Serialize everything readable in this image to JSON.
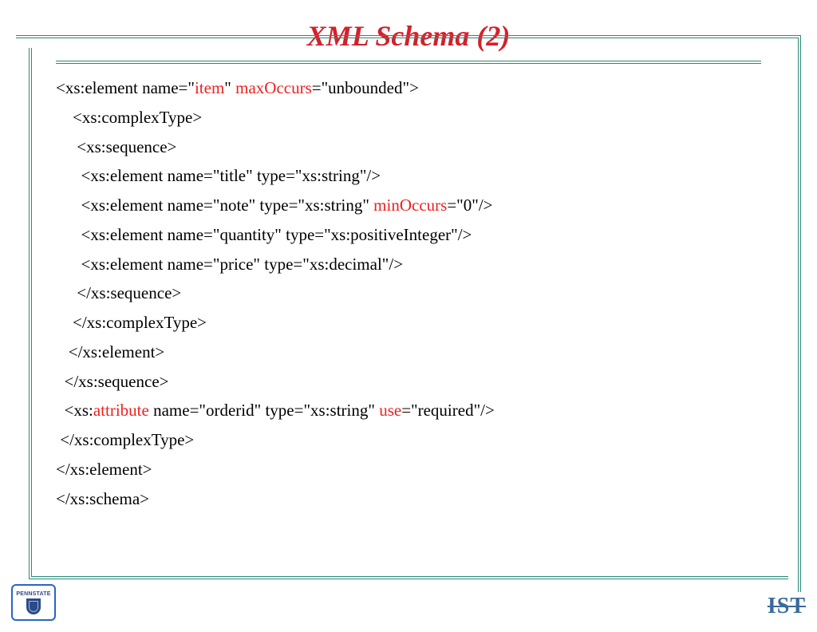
{
  "title": "XML Schema (2)",
  "code": {
    "l1a": "<xs:element name=\"",
    "l1b": "item",
    "l1c": "\" ",
    "l1d": "maxOccurs",
    "l1e": "=\"unbounded\">",
    "l2": "    <xs:complexType>",
    "l3": "     <xs:sequence>",
    "l4": "      <xs:element name=\"title\" type=\"xs:string\"/>",
    "l5a": "      <xs:element name=\"note\" type=\"xs:string\" ",
    "l5b": "minOccurs",
    "l5c": "=\"0\"/>",
    "l6": "      <xs:element name=\"quantity\" type=\"xs:positiveInteger\"/>",
    "l7": "      <xs:element name=\"price\" type=\"xs:decimal\"/>",
    "l8": "     </xs:sequence>",
    "l9": "    </xs:complexType>",
    "l10": "   </xs:element>",
    "l11": "  </xs:sequence>",
    "l12a": "  <xs:",
    "l12b": "attribute",
    "l12c": " name=\"orderid\" type=\"xs:string\" ",
    "l12d": "use",
    "l12e": "=\"required\"/>",
    "l13": " </xs:complexType>",
    "l14": "</xs:element>",
    "l15": "</xs:schema>"
  },
  "logos": {
    "left_label": "PENNSTATE",
    "right_label": "IST"
  }
}
